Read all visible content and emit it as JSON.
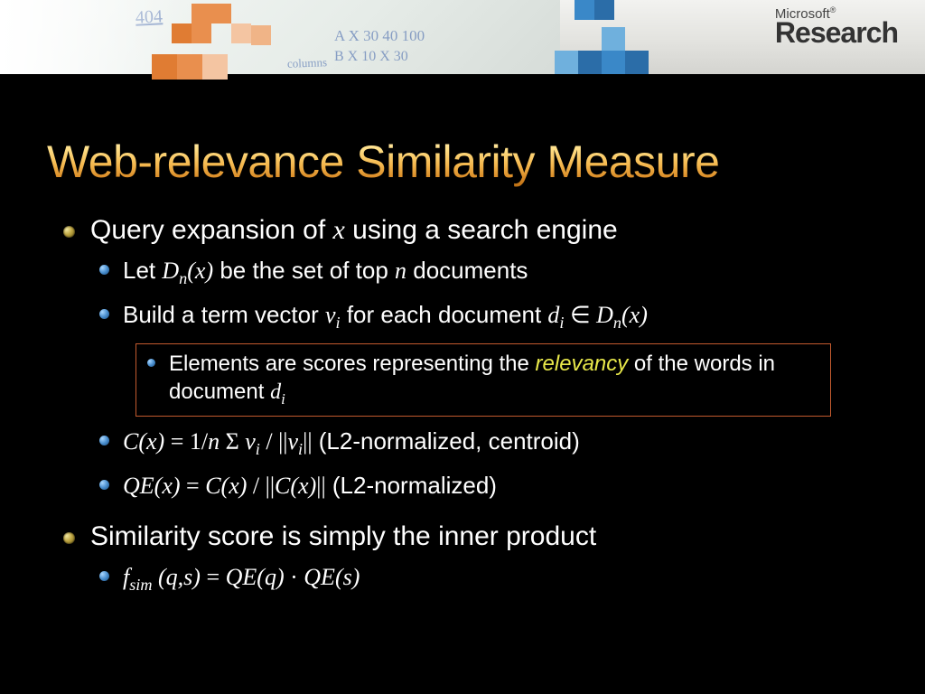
{
  "brand": {
    "line1": "Microsoft",
    "sup": "®",
    "line2": "Research"
  },
  "title": "Web-relevance Similarity Measure",
  "body": {
    "p1": {
      "pre": "Query expansion of ",
      "x": "x",
      "post": " using a search engine"
    },
    "p1a": {
      "pre": "Let ",
      "Dn": "D",
      "n": "n",
      "openx": "(x)",
      "mid": " be the set of top ",
      "nvar": "n",
      "post": " documents"
    },
    "p1b": {
      "pre": "Build a term vector ",
      "v": "v",
      "i": "i",
      "mid": " for each document ",
      "d": "d",
      "i2": "i",
      "in": " ∈ ",
      "D": "D",
      "n2": "n",
      "openx2": "(x)"
    },
    "p1c": {
      "pre": "Elements are scores representing the ",
      "hl": "relevancy",
      "mid": " of the words in document ",
      "d": "d",
      "i": "i"
    },
    "p1d": {
      "lhs_C": "C",
      "lhs_x": "(x)",
      "eq": " = ",
      "inv": "1/",
      "n": "n ",
      "sigma": "Σ ",
      "v1": "v",
      "i1": "i",
      "slash": " / ||",
      "v2": "v",
      "i2": "i",
      "close": "||",
      "note": "   (L2-normalized, centroid)"
    },
    "p1e": {
      "QE": "QE",
      "x1": "(x)",
      "eq": " = ",
      "C1": "C",
      "x2": "(x)",
      "slash": " / ||",
      "C2": "C",
      "x3": "(x)",
      "close": "||",
      "note": " (L2-normalized)"
    },
    "p2": "Similarity score is simply the inner product",
    "p2a": {
      "f": "f",
      "sim": "sim",
      "args": " (q,s) ",
      "eq": "= ",
      "QE1": "QE",
      "q": "(q)",
      "dot": " · ",
      "QE2": "QE",
      "s": "(s)"
    }
  },
  "scribbles": {
    "a": "A   X  30  40  100",
    "b": "B   X  10  X   30",
    "c": "404",
    "d": "columns"
  }
}
